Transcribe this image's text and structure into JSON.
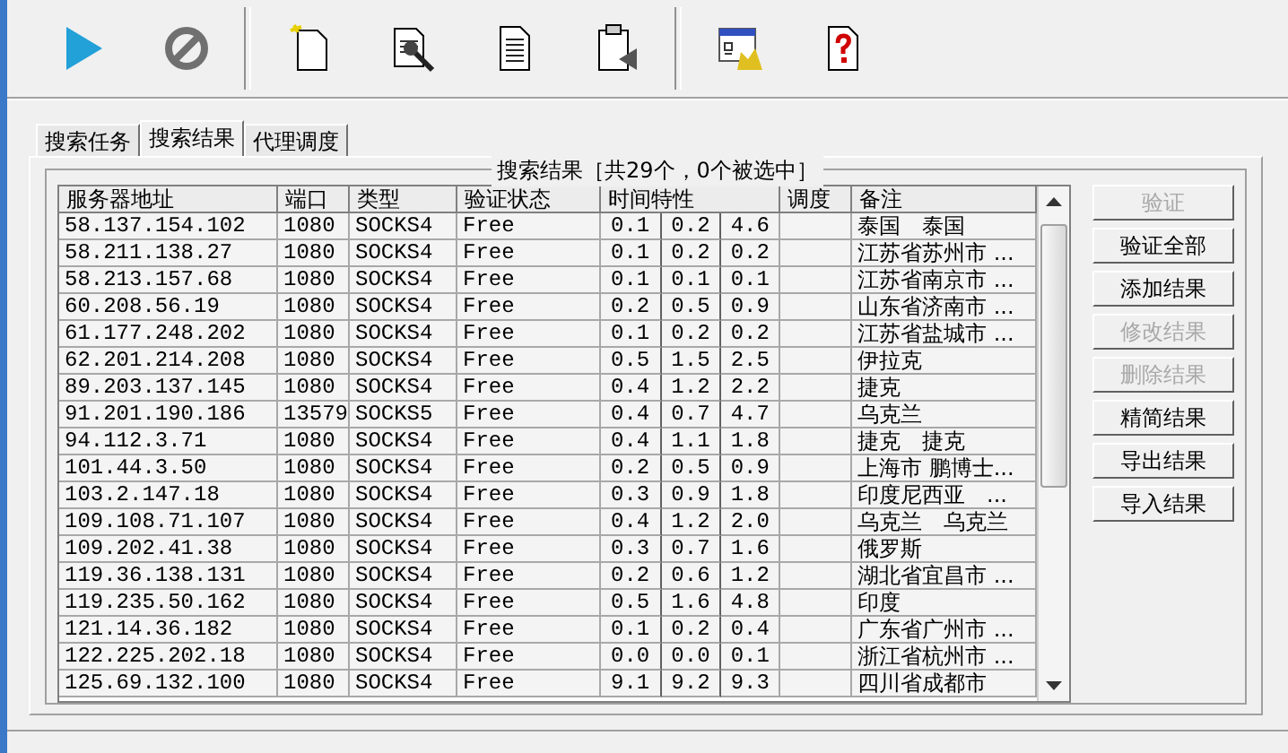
{
  "toolbar": [
    {
      "kind": "play"
    },
    {
      "kind": "stop"
    },
    {
      "kind": "sep"
    },
    {
      "kind": "new"
    },
    {
      "kind": "tool"
    },
    {
      "kind": "doc"
    },
    {
      "kind": "clip"
    },
    {
      "kind": "sep"
    },
    {
      "kind": "config"
    },
    {
      "kind": "help"
    }
  ],
  "tabs": [
    {
      "label": "搜索任务",
      "selected": false
    },
    {
      "label": "搜索结果",
      "selected": true
    },
    {
      "label": "代理调度",
      "selected": false
    }
  ],
  "group_title": "搜索结果［共29个，0个被选中］",
  "table": {
    "columns": [
      "服务器地址",
      "端口",
      "类型",
      "验证状态",
      "时间特性",
      "调度",
      "备注"
    ],
    "rows": [
      {
        "address": "58.137.154.102",
        "port": "1080",
        "type": "SOCKS4",
        "status": "Free",
        "time": [
          "0.1",
          "0.2",
          "4.6"
        ],
        "note": "泰国　泰国"
      },
      {
        "address": "58.211.138.27",
        "port": "1080",
        "type": "SOCKS4",
        "status": "Free",
        "time": [
          "0.1",
          "0.2",
          "0.2"
        ],
        "note": "江苏省苏州市 ..."
      },
      {
        "address": "58.213.157.68",
        "port": "1080",
        "type": "SOCKS4",
        "status": "Free",
        "time": [
          "0.1",
          "0.1",
          "0.1"
        ],
        "note": "江苏省南京市 ..."
      },
      {
        "address": "60.208.56.19",
        "port": "1080",
        "type": "SOCKS4",
        "status": "Free",
        "time": [
          "0.2",
          "0.5",
          "0.9"
        ],
        "note": "山东省济南市 ..."
      },
      {
        "address": "61.177.248.202",
        "port": "1080",
        "type": "SOCKS4",
        "status": "Free",
        "time": [
          "0.1",
          "0.2",
          "0.2"
        ],
        "note": "江苏省盐城市 ..."
      },
      {
        "address": "62.201.214.208",
        "port": "1080",
        "type": "SOCKS4",
        "status": "Free",
        "time": [
          "0.5",
          "1.5",
          "2.5"
        ],
        "note": "伊拉克"
      },
      {
        "address": "89.203.137.145",
        "port": "1080",
        "type": "SOCKS4",
        "status": "Free",
        "time": [
          "0.4",
          "1.2",
          "2.2"
        ],
        "note": "捷克"
      },
      {
        "address": "91.201.190.186",
        "port": "13579",
        "type": "SOCKS5",
        "status": "Free",
        "time": [
          "0.4",
          "0.7",
          "4.7"
        ],
        "note": "乌克兰"
      },
      {
        "address": "94.112.3.71",
        "port": "1080",
        "type": "SOCKS4",
        "status": "Free",
        "time": [
          "0.4",
          "1.1",
          "1.8"
        ],
        "note": "捷克　捷克"
      },
      {
        "address": "101.44.3.50",
        "port": "1080",
        "type": "SOCKS4",
        "status": "Free",
        "time": [
          "0.2",
          "0.5",
          "0.9"
        ],
        "note": "上海市 鹏博士..."
      },
      {
        "address": "103.2.147.18",
        "port": "1080",
        "type": "SOCKS4",
        "status": "Free",
        "time": [
          "0.3",
          "0.9",
          "1.8"
        ],
        "note": "印度尼西亚　..."
      },
      {
        "address": "109.108.71.107",
        "port": "1080",
        "type": "SOCKS4",
        "status": "Free",
        "time": [
          "0.4",
          "1.2",
          "2.0"
        ],
        "note": "乌克兰　乌克兰"
      },
      {
        "address": "109.202.41.38",
        "port": "1080",
        "type": "SOCKS4",
        "status": "Free",
        "time": [
          "0.3",
          "0.7",
          "1.6"
        ],
        "note": "俄罗斯"
      },
      {
        "address": "119.36.138.131",
        "port": "1080",
        "type": "SOCKS4",
        "status": "Free",
        "time": [
          "0.2",
          "0.6",
          "1.2"
        ],
        "note": "湖北省宜昌市 ..."
      },
      {
        "address": "119.235.50.162",
        "port": "1080",
        "type": "SOCKS4",
        "status": "Free",
        "time": [
          "0.5",
          "1.6",
          "4.8"
        ],
        "note": "印度"
      },
      {
        "address": "121.14.36.182",
        "port": "1080",
        "type": "SOCKS4",
        "status": "Free",
        "time": [
          "0.1",
          "0.2",
          "0.4"
        ],
        "note": "广东省广州市 ..."
      },
      {
        "address": "122.225.202.18",
        "port": "1080",
        "type": "SOCKS4",
        "status": "Free",
        "time": [
          "0.0",
          "0.0",
          "0.1"
        ],
        "note": "浙江省杭州市 ..."
      },
      {
        "address": "125.69.132.100",
        "port": "1080",
        "type": "SOCKS4",
        "status": "Free",
        "time": [
          "9.1",
          "9.2",
          "9.3"
        ],
        "note": "四川省成都市"
      }
    ]
  },
  "buttons": [
    {
      "label": "验证",
      "disabled": true
    },
    {
      "label": "验证全部",
      "disabled": false
    },
    {
      "label": "添加结果",
      "disabled": false
    },
    {
      "label": "修改结果",
      "disabled": true
    },
    {
      "label": "删除结果",
      "disabled": true
    },
    {
      "label": "精简结果",
      "disabled": false
    },
    {
      "label": "导出结果",
      "disabled": false
    },
    {
      "label": "导入结果",
      "disabled": false
    }
  ]
}
